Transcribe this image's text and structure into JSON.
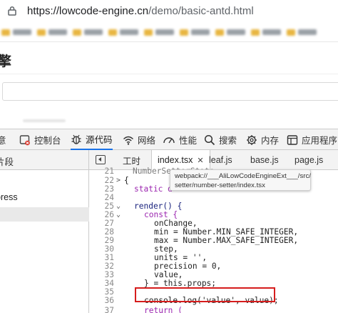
{
  "browser": {
    "url_host": "https://lowcode-engine.cn",
    "url_path": "/demo/basic-antd.html"
  },
  "webpage": {
    "heading_fragment": "擎"
  },
  "devtools": {
    "tabs": [
      {
        "label": "控制台",
        "icon": "console-icon"
      },
      {
        "label": "源代码",
        "icon": "bug-icon"
      },
      {
        "label": "网络",
        "icon": "wifi-icon"
      },
      {
        "label": "性能",
        "icon": "gauge-icon"
      },
      {
        "label": "搜索",
        "icon": "search-icon"
      },
      {
        "label": "内存",
        "icon": "gear-icon"
      },
      {
        "label": "应用程序",
        "icon": "app-window-icon"
      }
    ],
    "left_edge_label": "意",
    "navigator_label": "片段",
    "navigator_item": "press",
    "source_label": "工时",
    "file_tabs": [
      {
        "label": "index.tsx",
        "active": true
      },
      {
        "label": "leaf.js"
      },
      {
        "label": "base.js"
      },
      {
        "label": "page.js"
      }
    ],
    "close_glyph": "✕"
  },
  "tooltip": {
    "line1": "webpack://___AliLowCodeEngineExt___/src/",
    "line2": "setter/number-setter/index.tsx"
  },
  "code": {
    "line_numbers": [
      "21",
      "22",
      "23",
      "24",
      "25",
      "26",
      "27",
      "28",
      "29",
      "30",
      "31",
      "32",
      "33",
      "34",
      "35",
      "36",
      "37"
    ],
    "lines": [
      "NumberSetterState",
      "{",
      "static d",
      "",
      "render() {",
      "const {",
      "onChange,",
      "min = Number.MIN_SAFE_INTEGER,",
      "max = Number.MAX_SAFE_INTEGER,",
      "step,",
      "units = '',",
      "precision = 0,",
      "value,",
      "} = this.props;",
      "",
      "console.log('value', value);",
      "return ("
    ]
  }
}
